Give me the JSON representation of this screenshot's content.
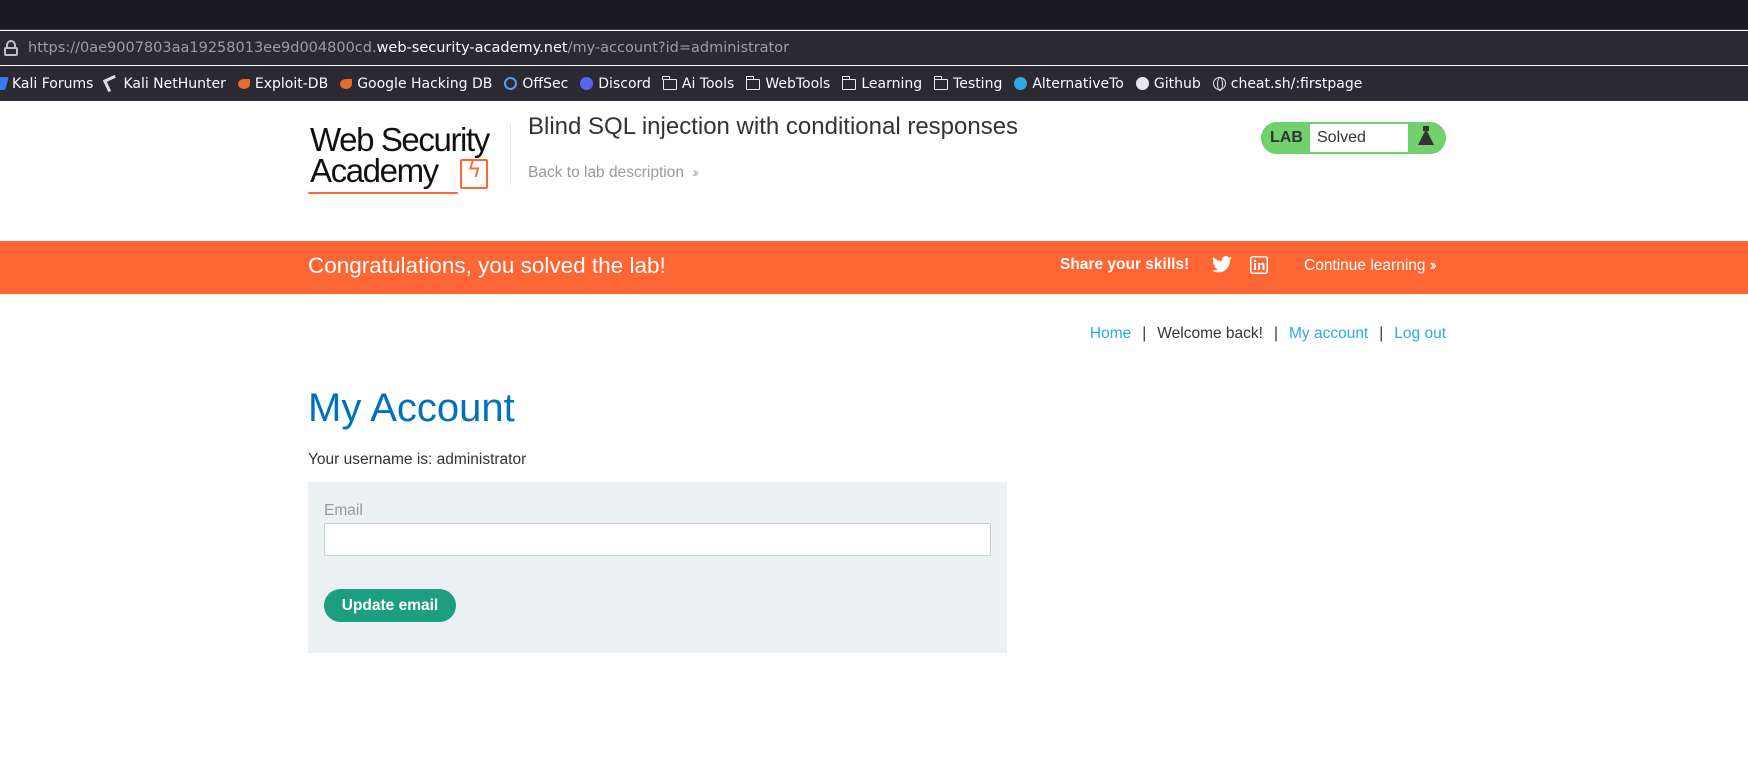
{
  "browser": {
    "url_scheme": "https://",
    "url_subdomain": "0ae9007803aa19258013ee9d004800cd.",
    "url_host": "web-security-academy.net",
    "url_path": "/my-account?id=administrator",
    "bookmarks": [
      {
        "label": "Kali Forums",
        "icon": "kali-icon"
      },
      {
        "label": "Kali NetHunter",
        "icon": "nethunter-icon"
      },
      {
        "label": "Exploit-DB",
        "icon": "exploit-db-icon"
      },
      {
        "label": "Google Hacking DB",
        "icon": "exploit-db-icon"
      },
      {
        "label": "OffSec",
        "icon": "offsec-icon"
      },
      {
        "label": "Discord",
        "icon": "discord-icon"
      },
      {
        "label": "Ai Tools",
        "icon": "folder-icon"
      },
      {
        "label": "WebTools",
        "icon": "folder-icon"
      },
      {
        "label": "Learning",
        "icon": "folder-icon"
      },
      {
        "label": "Testing",
        "icon": "folder-icon"
      },
      {
        "label": "AlternativeTo",
        "icon": "alternativeto-icon"
      },
      {
        "label": "Github",
        "icon": "github-icon"
      },
      {
        "label": "cheat.sh/:firstpage",
        "icon": "globe-icon"
      }
    ]
  },
  "header": {
    "logo_line1": "Web Security",
    "logo_line2": "Academy",
    "lab_title": "Blind SQL injection with conditional responses",
    "back_link": "Back to lab description",
    "lab_tag": "LAB",
    "lab_state": "Solved"
  },
  "banner": {
    "message": "Congratulations, you solved the lab!",
    "share": "Share your skills!",
    "continue": "Continue learning",
    "color": "#ff6633"
  },
  "nav": {
    "home": "Home",
    "welcome": "Welcome back!",
    "my_account": "My account",
    "log_out": "Log out",
    "separator": "|"
  },
  "main": {
    "title": "My Account",
    "username_text": "Your username is: administrator",
    "email_label": "Email",
    "email_value": "",
    "update_button": "Update email"
  }
}
